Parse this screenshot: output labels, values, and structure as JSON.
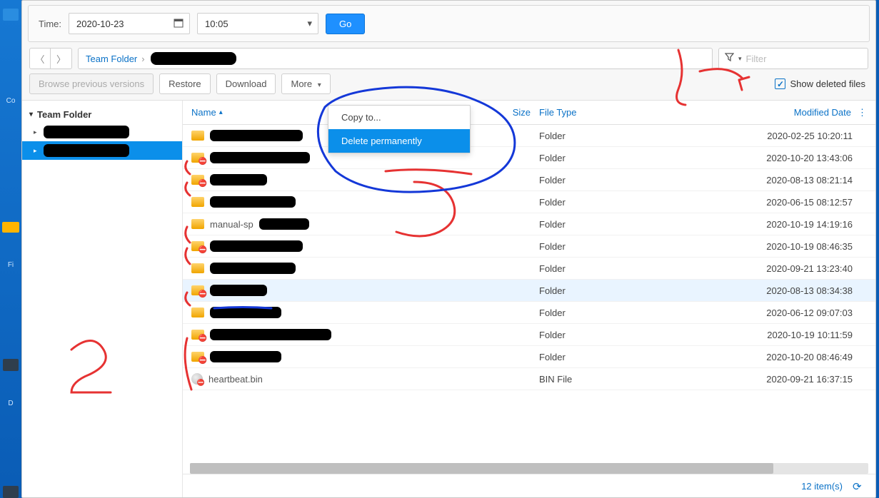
{
  "timebar": {
    "label": "Time:",
    "date": "2020-10-23",
    "time": "10:05",
    "go": "Go"
  },
  "breadcrumb": {
    "root": "Team Folder"
  },
  "filter": {
    "placeholder": "Filter"
  },
  "toolbar": {
    "browse": "Browse previous versions",
    "restore": "Restore",
    "download": "Download",
    "more": "More",
    "show_deleted": "Show deleted files",
    "show_deleted_checked": true
  },
  "menu": {
    "copy": "Copy to...",
    "delete": "Delete permanently"
  },
  "tree": {
    "root": "Team Folder"
  },
  "columns": {
    "name": "Name",
    "size": "Size",
    "type": "File Type",
    "modified": "Modified Date"
  },
  "rows": [
    {
      "redacted": true,
      "redact_w": 130,
      "deleted": false,
      "type": "Folder",
      "modified": "2020-02-25 10:20:11"
    },
    {
      "redacted": true,
      "redact_w": 140,
      "deleted": true,
      "type": "Folder",
      "modified": "2020-10-20 13:43:06"
    },
    {
      "redacted": true,
      "redact_w": 80,
      "deleted": true,
      "type": "Folder",
      "modified": "2020-08-13 08:21:14"
    },
    {
      "redacted": true,
      "redact_w": 120,
      "deleted": false,
      "type": "Folder",
      "modified": "2020-06-15 08:12:57"
    },
    {
      "name": "manual-sp",
      "redacted": true,
      "redact_w": 70,
      "deleted": false,
      "type": "Folder",
      "modified": "2020-10-19 14:19:16"
    },
    {
      "redacted": true,
      "redact_w": 130,
      "deleted": true,
      "type": "Folder",
      "modified": "2020-10-19 08:46:35"
    },
    {
      "redacted": true,
      "redact_w": 120,
      "deleted": false,
      "type": "Folder",
      "modified": "2020-09-21 13:23:40"
    },
    {
      "redacted": true,
      "redact_w": 80,
      "deleted": true,
      "type": "Folder",
      "modified": "2020-08-13 08:34:38",
      "highlight": true
    },
    {
      "redacted": true,
      "redact_w": 100,
      "deleted": false,
      "type": "Folder",
      "modified": "2020-06-12 09:07:03"
    },
    {
      "redacted": true,
      "redact_w": 170,
      "deleted": true,
      "type": "Folder",
      "modified": "2020-10-19 10:11:59"
    },
    {
      "redacted": true,
      "redact_w": 100,
      "deleted": true,
      "type": "Folder",
      "modified": "2020-10-20 08:46:49"
    },
    {
      "name": "heartbeat.bin",
      "redacted": false,
      "deleted": true,
      "icon": "bin",
      "type": "BIN File",
      "modified": "2020-09-21 16:37:15"
    }
  ],
  "status": {
    "count_text": "12 item(s)"
  },
  "annotations": {
    "one": "1",
    "two": "2",
    "three": "3"
  }
}
